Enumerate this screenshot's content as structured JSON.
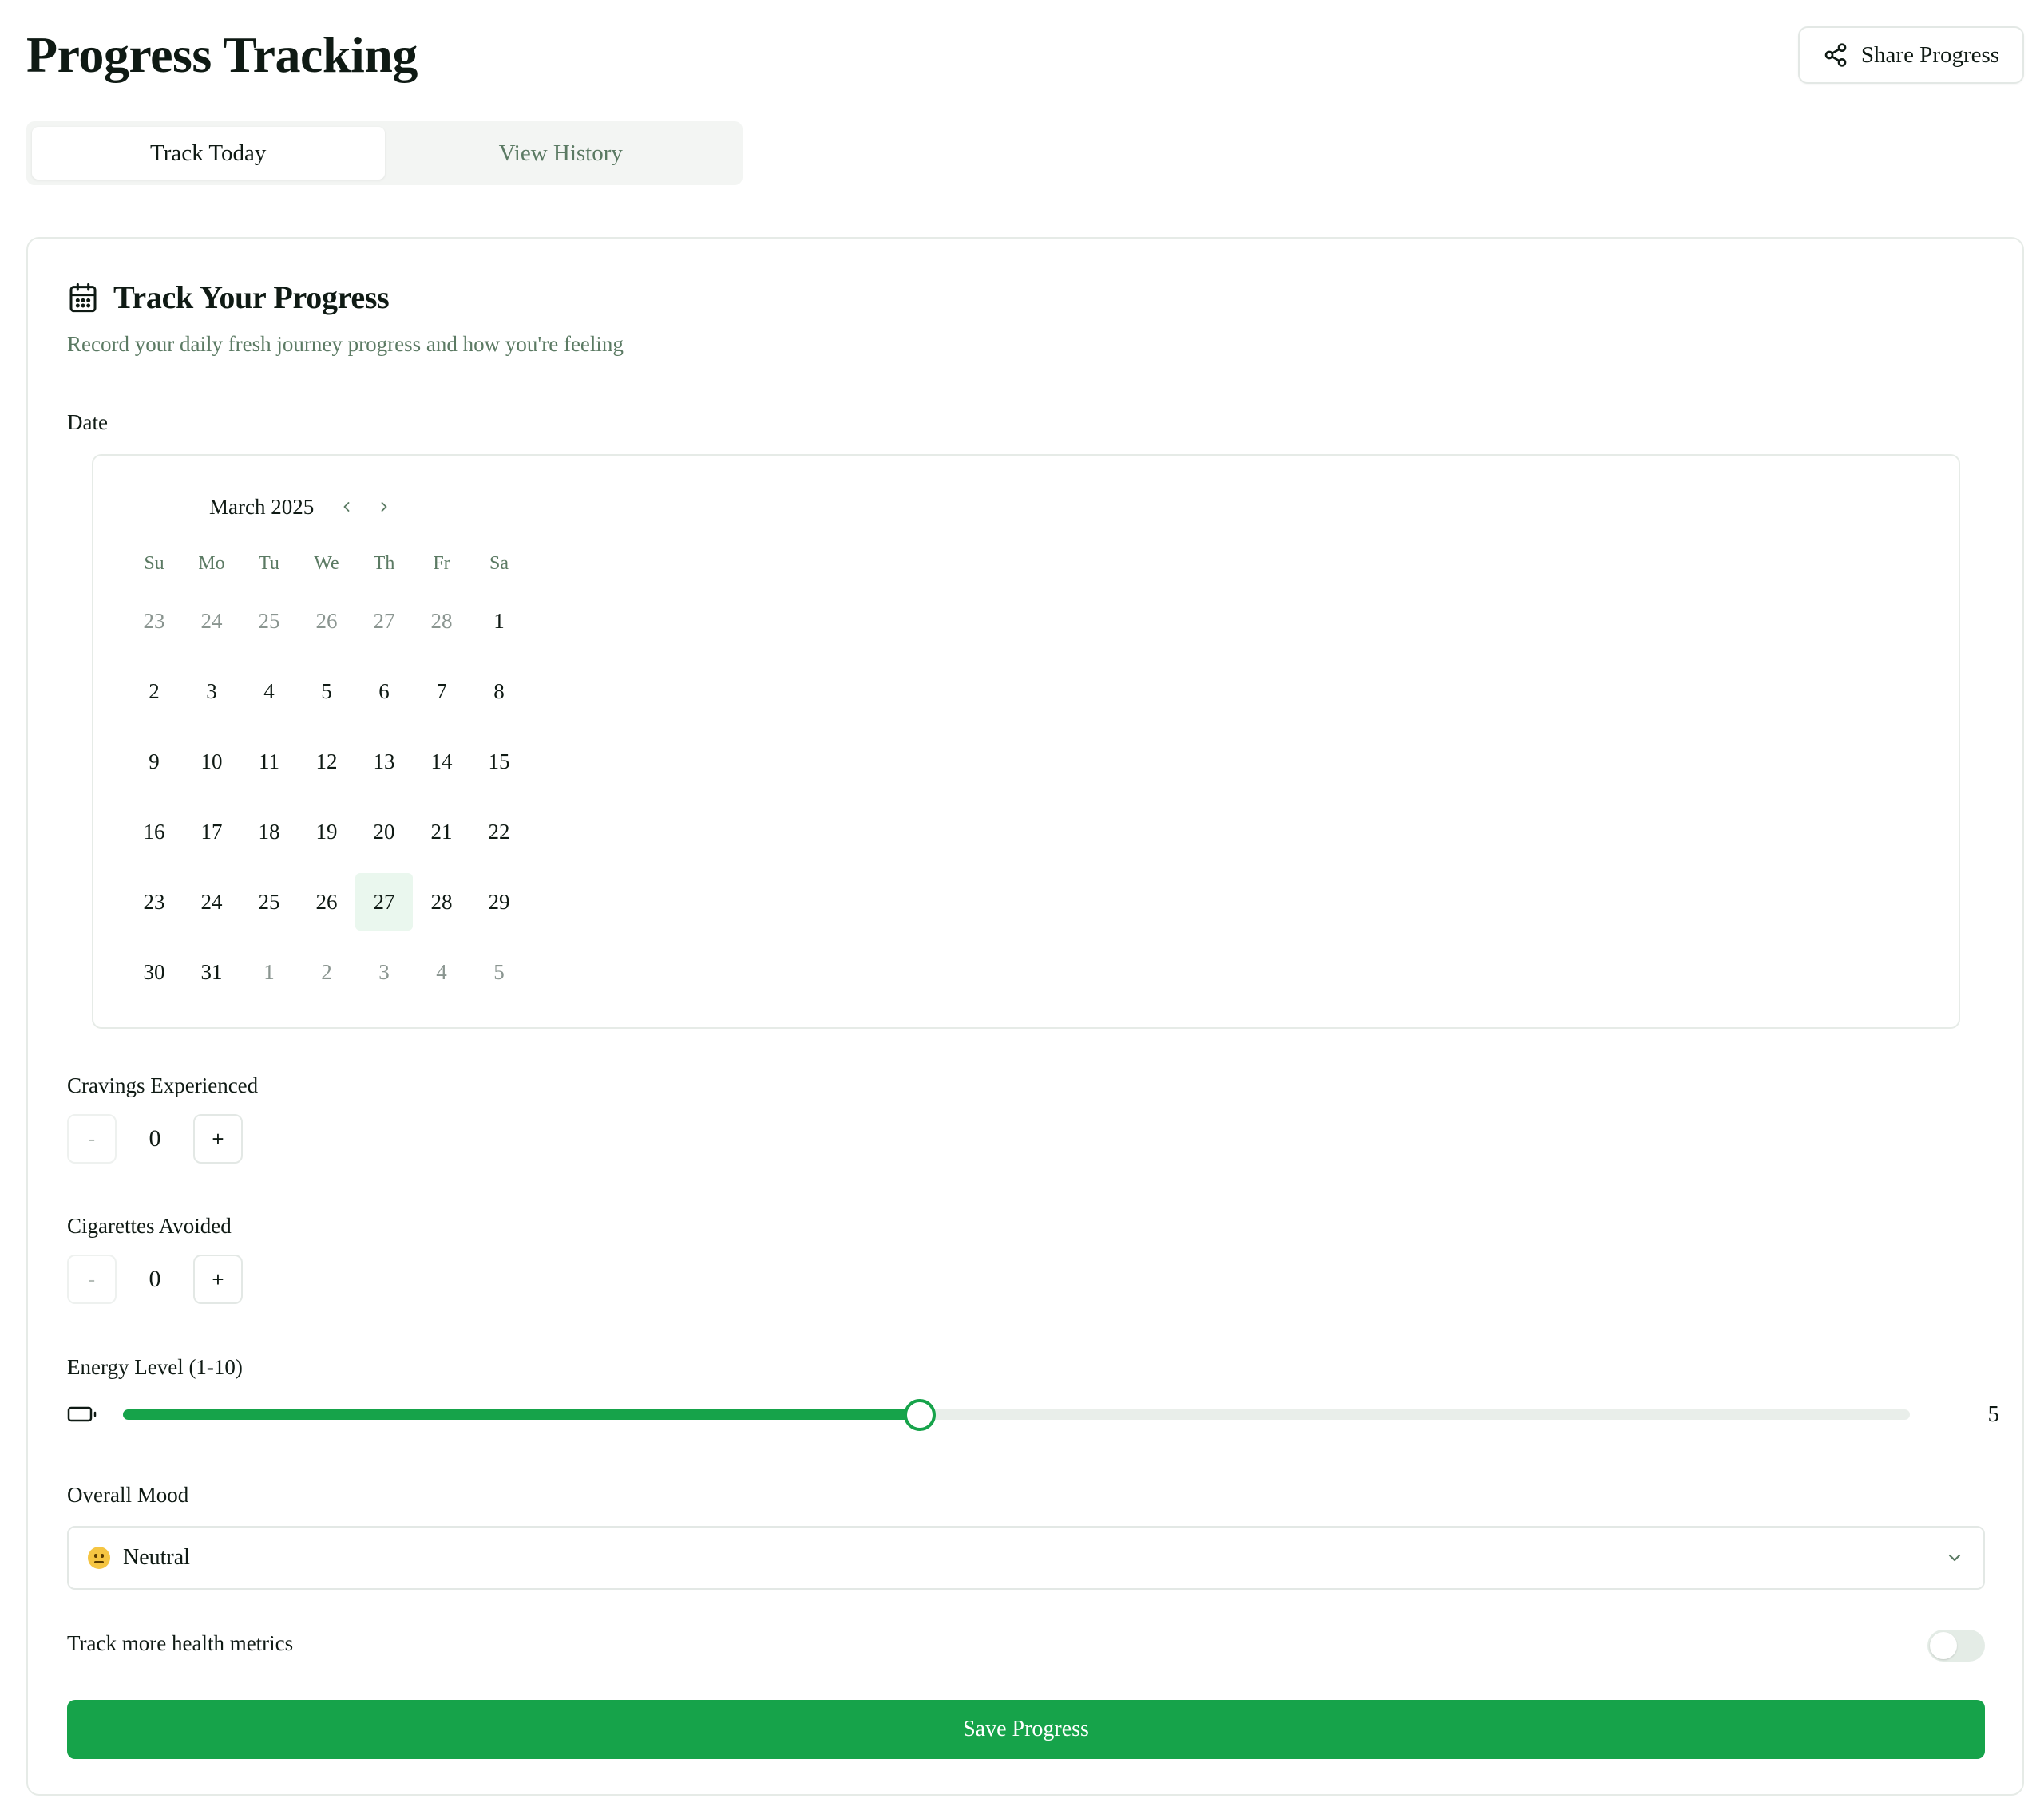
{
  "page": {
    "title": "Progress Tracking",
    "share_label": "Share Progress"
  },
  "tabs": [
    {
      "label": "Track Today",
      "active": true
    },
    {
      "label": "View History",
      "active": false
    }
  ],
  "card": {
    "title": "Track Your Progress",
    "subtitle": "Record your daily fresh journey progress and how you're feeling"
  },
  "date": {
    "label": "Date",
    "month_label": "March 2025",
    "weekdays": [
      "Su",
      "Mo",
      "Tu",
      "We",
      "Th",
      "Fr",
      "Sa"
    ],
    "weeks": [
      [
        {
          "d": "23",
          "muted": true
        },
        {
          "d": "24",
          "muted": true
        },
        {
          "d": "25",
          "muted": true
        },
        {
          "d": "26",
          "muted": true
        },
        {
          "d": "27",
          "muted": true
        },
        {
          "d": "28",
          "muted": true
        },
        {
          "d": "1"
        }
      ],
      [
        {
          "d": "2"
        },
        {
          "d": "3"
        },
        {
          "d": "4"
        },
        {
          "d": "5"
        },
        {
          "d": "6"
        },
        {
          "d": "7"
        },
        {
          "d": "8"
        }
      ],
      [
        {
          "d": "9"
        },
        {
          "d": "10"
        },
        {
          "d": "11"
        },
        {
          "d": "12"
        },
        {
          "d": "13"
        },
        {
          "d": "14"
        },
        {
          "d": "15"
        }
      ],
      [
        {
          "d": "16"
        },
        {
          "d": "17"
        },
        {
          "d": "18"
        },
        {
          "d": "19"
        },
        {
          "d": "20"
        },
        {
          "d": "21"
        },
        {
          "d": "22"
        }
      ],
      [
        {
          "d": "23"
        },
        {
          "d": "24"
        },
        {
          "d": "25"
        },
        {
          "d": "26"
        },
        {
          "d": "27",
          "today": true
        },
        {
          "d": "28"
        },
        {
          "d": "29"
        }
      ],
      [
        {
          "d": "30"
        },
        {
          "d": "31"
        },
        {
          "d": "1",
          "muted": true
        },
        {
          "d": "2",
          "muted": true
        },
        {
          "d": "3",
          "muted": true
        },
        {
          "d": "4",
          "muted": true
        },
        {
          "d": "5",
          "muted": true
        }
      ]
    ]
  },
  "cravings": {
    "label": "Cravings Experienced",
    "value": "0",
    "decrement_label": "-",
    "increment_label": "+"
  },
  "cigarettes": {
    "label": "Cigarettes Avoided",
    "value": "0",
    "decrement_label": "-",
    "increment_label": "+"
  },
  "energy": {
    "label": "Energy Level (1-10)",
    "value": "5",
    "fill_fraction": 0.446,
    "icon": "battery-icon"
  },
  "mood": {
    "label": "Overall Mood",
    "selected": "Neutral",
    "icon": "neutral-face-icon"
  },
  "health_toggle": {
    "label": "Track more health metrics",
    "on": false
  },
  "save_label": "Save Progress",
  "colors": {
    "accent": "#16a34a",
    "muted_text": "#5b7a63",
    "today_bg": "#eaf7ee"
  }
}
